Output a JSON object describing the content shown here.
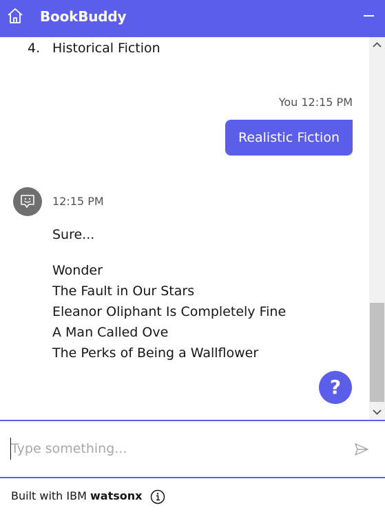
{
  "header": {
    "title": "BookBuddy",
    "home_icon": "home-icon",
    "minimize_icon": "minimize-icon",
    "background": "#5b5ee8"
  },
  "chat": {
    "previous_list_item": {
      "number": "4.",
      "text": "Historical Fiction"
    },
    "user_message": {
      "meta": "You 12:15 PM",
      "text": "Realistic Fiction"
    },
    "bot_message": {
      "avatar_icon": "chat-bot-icon",
      "time": "12:15 PM",
      "intro": "Sure...",
      "books": [
        "Wonder",
        "The Fault in Our Stars",
        "Eleanor Oliphant Is Completely Fine",
        "A Man Called Ove",
        "The Perks of Being a Wallflower"
      ]
    },
    "help_button": "?"
  },
  "input": {
    "placeholder": "Type something...",
    "value": "",
    "send_icon": "send-icon"
  },
  "footer": {
    "prefix": "Built with IBM",
    "brand": "watsonx",
    "info_icon": "info-icon"
  },
  "colors": {
    "accent": "#5b5ee8",
    "avatar": "#6f6f6f"
  }
}
